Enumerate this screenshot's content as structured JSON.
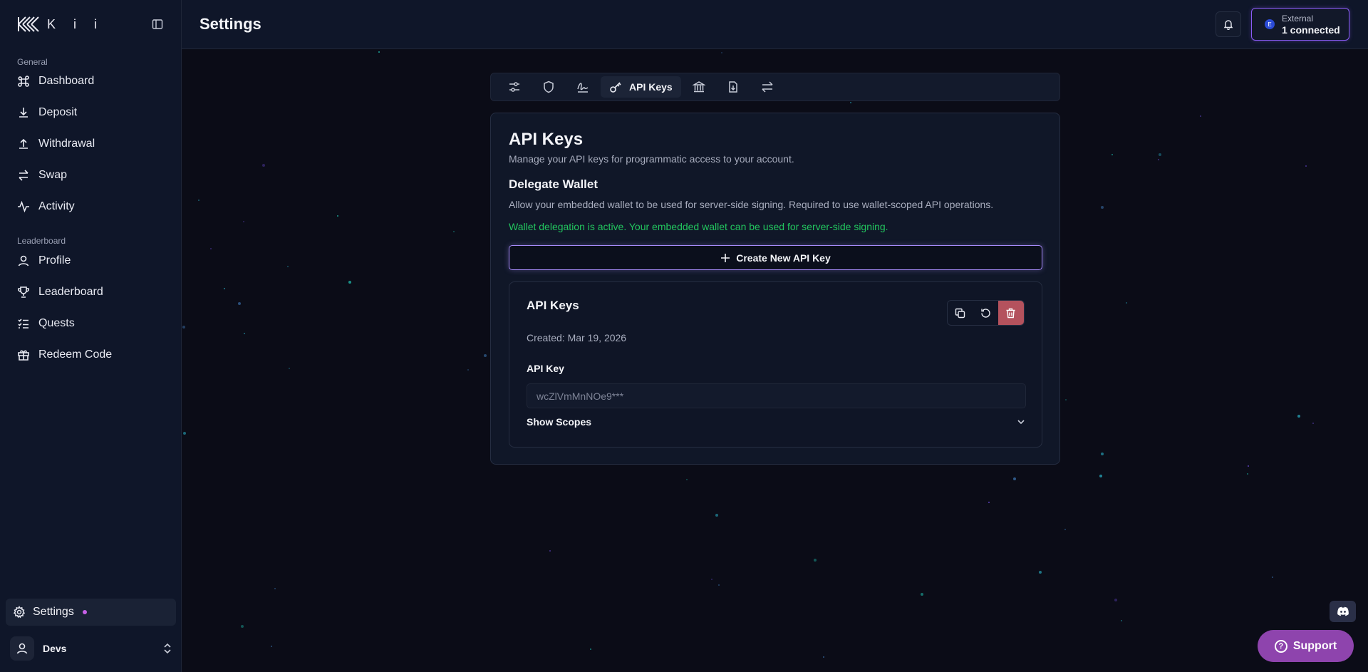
{
  "app": {
    "logo_text": "K i i",
    "page_title": "Settings"
  },
  "sidebar": {
    "sections": [
      {
        "label": "General",
        "items": [
          {
            "label": "Dashboard",
            "icon": "command-icon"
          },
          {
            "label": "Deposit",
            "icon": "download-icon"
          },
          {
            "label": "Withdrawal",
            "icon": "upload-icon"
          },
          {
            "label": "Swap",
            "icon": "swap-icon"
          },
          {
            "label": "Activity",
            "icon": "activity-icon"
          }
        ]
      },
      {
        "label": "Leaderboard",
        "items": [
          {
            "label": "Profile",
            "icon": "user-icon"
          },
          {
            "label": "Leaderboard",
            "icon": "trophy-icon"
          },
          {
            "label": "Quests",
            "icon": "list-checks-icon"
          },
          {
            "label": "Redeem Code",
            "icon": "gift-icon"
          }
        ]
      }
    ],
    "active_item": {
      "label": "Settings",
      "icon": "gear-icon"
    },
    "user": {
      "name": "Devs"
    }
  },
  "header": {
    "external": {
      "badge": "E",
      "label": "External",
      "status": "1 connected"
    }
  },
  "tabs": {
    "active_label": "API Keys",
    "icons": [
      "sliders-icon",
      "shield-icon",
      "signature-icon",
      "key-icon",
      "bank-icon",
      "file-download-icon",
      "arrows-swap-icon"
    ]
  },
  "card": {
    "title": "API Keys",
    "subtitle": "Manage your API keys for programmatic access to your account.",
    "delegate": {
      "title": "Delegate Wallet",
      "description": "Allow your embedded wallet to be used for server-side signing. Required to use wallet-scoped API operations.",
      "status": "Wallet delegation is active. Your embedded wallet can be used for server-side signing."
    },
    "create_button": "Create New API Key",
    "key": {
      "title": "API Keys",
      "created": "Created: Mar 19, 2026",
      "key_label": "API Key",
      "key_value": "wcZlVmMnNOe9***",
      "show_scopes": "Show Scopes"
    }
  },
  "support": {
    "label": "Support"
  },
  "colors": {
    "accent": "#8b5cf6",
    "success": "#22c55e",
    "danger": "#b4525d",
    "support": "#8e44ad"
  }
}
